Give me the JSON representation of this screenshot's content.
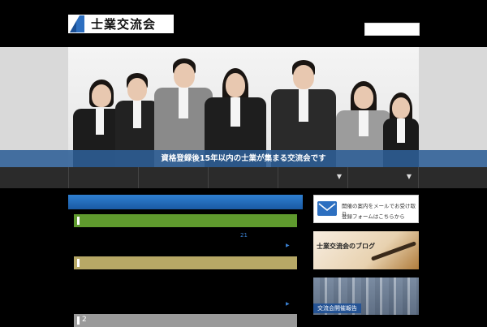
{
  "site": {
    "logo_text": "士業交流会"
  },
  "hero": {
    "caption": "資格登録後15年以内の士業が集まる交流会です"
  },
  "nav": {
    "items": [
      {
        "label": "",
        "has_dropdown": false
      },
      {
        "label": "",
        "has_dropdown": false
      },
      {
        "label": "",
        "has_dropdown": false
      },
      {
        "label": "",
        "has_dropdown": false
      },
      {
        "label": "",
        "has_dropdown": true
      },
      {
        "label": "",
        "has_dropdown": true
      }
    ]
  },
  "main": {
    "sections": [
      {
        "color": "#5f9a2e",
        "number": "",
        "note": "21"
      },
      {
        "color": "#b7a866",
        "number": "",
        "note": ""
      },
      {
        "color": "#9a9a9a",
        "number": "2",
        "note": ""
      }
    ]
  },
  "sidebar": {
    "mail_banner": {
      "line1": "開催の案内をメールでお受け取り",
      "line2": "登録フォームはこちらから",
      "icon": "envelope-icon"
    },
    "blog_banner": {
      "title": "士業交流会のブログ"
    },
    "report_banner": {
      "title": "交流会開催報告"
    }
  },
  "colors": {
    "accent_blue": "#2d6fc0",
    "caption_bar": "#2d5f96",
    "nav_bg": "#2b2b2b"
  }
}
